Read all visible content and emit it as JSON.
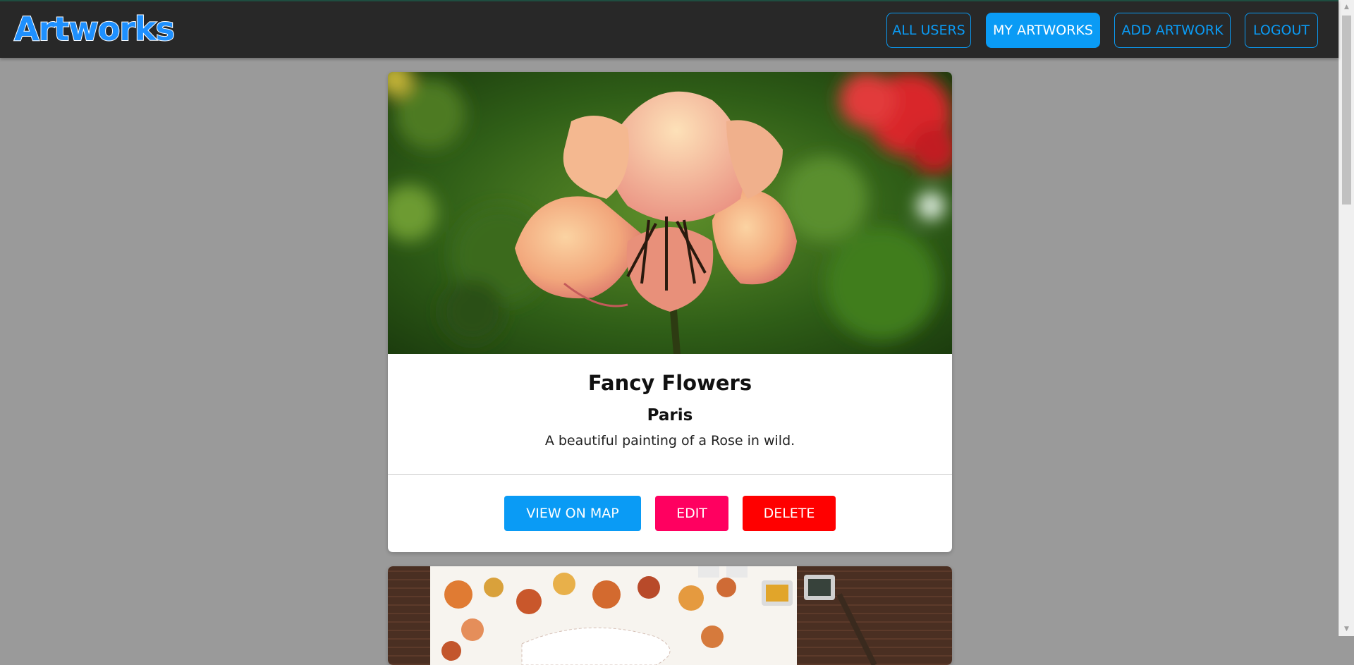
{
  "app": {
    "logo": "Artworks"
  },
  "nav": {
    "all_users": "ALL USERS",
    "my_artworks": "MY ARTWORKS",
    "add_artwork": "ADD ARTWORK",
    "logout": "LOGOUT",
    "active": "my_artworks"
  },
  "colors": {
    "accent": "#0a9bf5",
    "edit": "#ff0060",
    "delete": "#ff0000",
    "topbar": "#282828",
    "background": "#9a9a9a"
  },
  "artworks": [
    {
      "title": "Fancy Flowers",
      "location": "Paris",
      "description": "A beautiful painting of a Rose in wild.",
      "image": "rose-photo",
      "actions": {
        "map": "VIEW ON MAP",
        "edit": "EDIT",
        "delete": "DELETE"
      }
    },
    {
      "image": "watercolor-leaves-painting"
    }
  ]
}
